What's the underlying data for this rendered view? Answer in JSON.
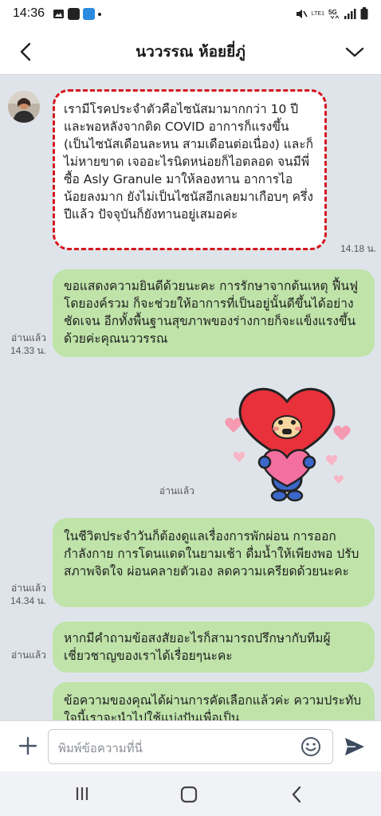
{
  "status_bar": {
    "time": "14:36",
    "lte_label": "LTE1",
    "icons": [
      "image-icon",
      "l-app-icon",
      "messenger-icon",
      "dot-icon",
      "mute-icon",
      "volte-icon",
      "5g-icon",
      "signal-icon",
      "battery-icon"
    ]
  },
  "header": {
    "title": "นววรรณ ห้อยยี่ภู่",
    "back_icon": "chevron-left-icon",
    "menu_icon": "chevron-down-icon"
  },
  "messages": [
    {
      "direction": "in",
      "text": "เรามีโรคประจำตัวคือไซนัสมามากกว่า 10 ปี และพอหลังจากติด COVID อาการก็แรงขึ้น (เป็นไซนัสเดือนละหน สามเดือนต่อเนื่อง) และก็ไม่หายขาด เจออะไรนิดหน่อยก็ไอตลอด จนมีพี่ซื้อ Asly Granule มาให้ลองทาน อาการไอน้อยลงมาก ยังไม่เป็นไซนัสอีกเลยมาเกือบๆ ครึ่งปีแล้ว ปัจจุบันก็ยังทานอยู่เสมอค่ะ",
      "time": "14.18 น.",
      "highlighted": true,
      "highlight_color": "#d6141c"
    },
    {
      "direction": "out",
      "text": "ขอแสดงความยินดีด้วยนะคะ การรักษาจากต้นเหตุ ฟื้นฟูโดยองค์รวม ก็จะช่วยให้อาการที่เป็นอยู่นั้นดีขึ้นได้อย่างชัดเจน อีกทั้งพื้นฐานสุขภาพของร่างกายก็จะแข็งแรงขึ้นด้วยค่ะคุณนววรรณ",
      "read": "อ่านแล้ว",
      "time": "14.33 น."
    },
    {
      "direction": "out",
      "type": "sticker",
      "sticker": "heart-character-sticker",
      "read": "อ่านแล้ว"
    },
    {
      "direction": "out",
      "text": "ในชีวิตประจำวันก็ต้องดูแลเรื่องการพักผ่อน การออกกำลังกาย การโดนแดดในยามเช้า ดื่มน้ำให้เพียงพอ ปรับสภาพจิตใจ ผ่อนคลายตัวเอง ลดความเครียดด้วยนะคะ",
      "read": "อ่านแล้ว",
      "time": "14.34 น."
    },
    {
      "direction": "out",
      "text": "หากมีคำถามข้อสงสัยอะไรก็สามารถปรึกษากับทีมผู้เชี่ยวชาญของเราได้เรื่อยๆนะคะ",
      "read": "อ่านแล้ว"
    },
    {
      "direction": "out",
      "text": "ข้อความของคุณได้ผ่านการคัดเลือกแล้วค่ะ ความประทับใจนี้เราจะนำไปใช้แบ่งปันเพื่อเป็น"
    }
  ],
  "input": {
    "placeholder": "พิมพ์ข้อความที่นี่",
    "plus_icon": "plus-icon",
    "emoji_icon": "emoji-icon",
    "send_icon": "send-icon"
  },
  "nav_bar": {
    "icons": [
      "recent-apps-icon",
      "home-icon",
      "back-icon"
    ]
  },
  "colors": {
    "chat_bg": "#dfe4ea",
    "outgoing_bubble": "#bfe3a9",
    "incoming_bubble": "#ffffff",
    "highlight_border": "#d6141c"
  }
}
